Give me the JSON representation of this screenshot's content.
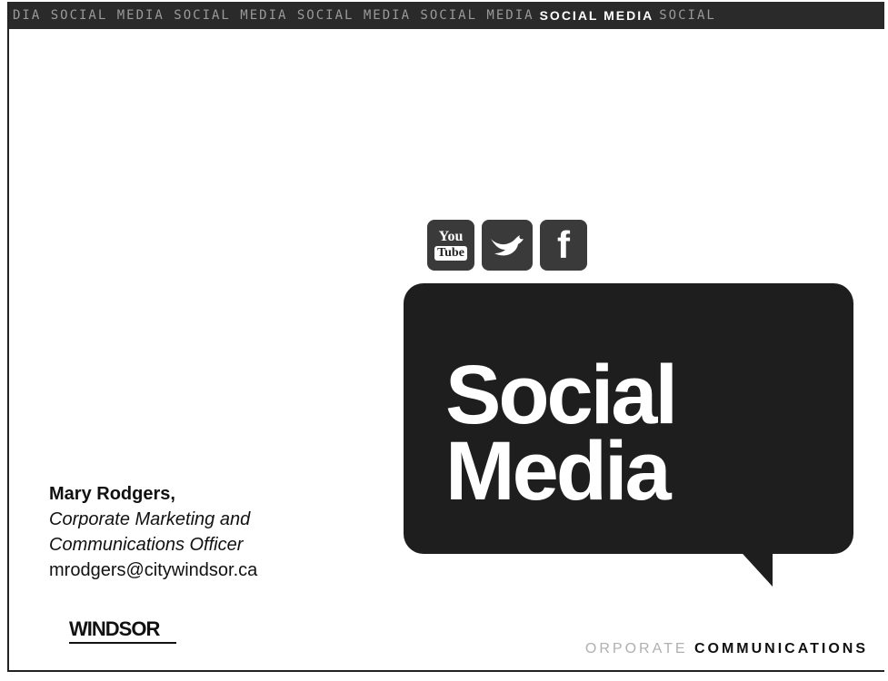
{
  "banner": {
    "repeat_text": "DIA SOCIAL MEDIA SOCIAL MEDIA SOCIAL MEDIA SOCIAL MEDIA",
    "highlight_text": "SOCIAL MEDIA",
    "tail_text": "SOCIAL"
  },
  "icons": {
    "youtube_top": "You",
    "youtube_bottom": "Tube",
    "facebook": "f"
  },
  "bubble": {
    "line1": "Social",
    "line2": "Media"
  },
  "contact": {
    "name": "Mary Rodgers,",
    "role_line1": "Corporate Marketing and",
    "role_line2": "Communications Officer",
    "email": "mrodgers@citywindsor.ca"
  },
  "logo": {
    "text": "WINDSOR"
  },
  "footer": {
    "light_text": "ORPORATE",
    "strong_text": "COMMUNICATIONS"
  },
  "colors": {
    "banner_bg": "#2a2a2a",
    "bubble_bg": "#1e1e1e",
    "text": "#111111"
  }
}
